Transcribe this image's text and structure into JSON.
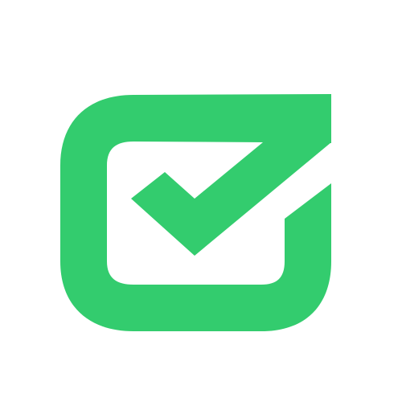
{
  "logo": {
    "icon": "checkbox-check-icon",
    "color": "#33CC6E",
    "background": "#FFFFFF"
  }
}
